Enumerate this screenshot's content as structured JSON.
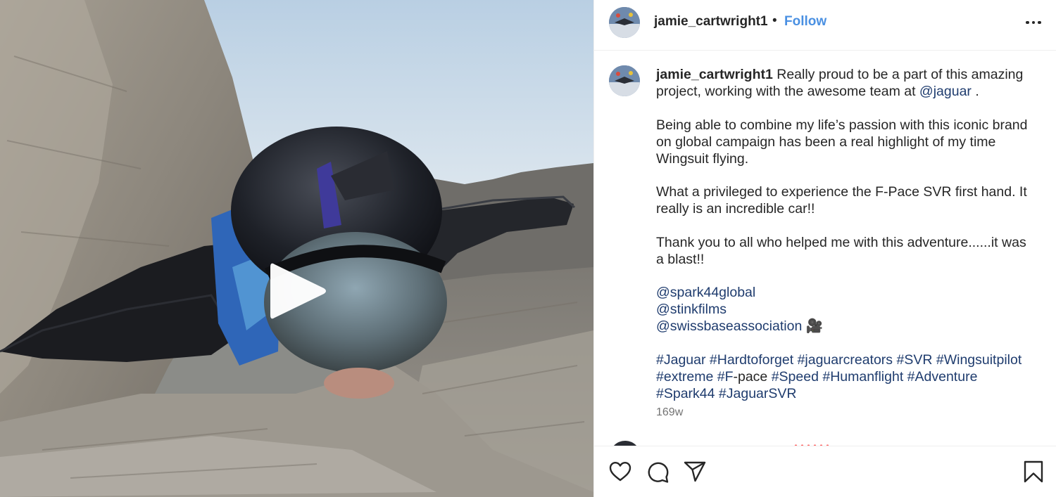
{
  "post": {
    "username": "jamie_cartwright1",
    "separator": "•",
    "follow_label": "Follow",
    "more_options_icon": "more-horizontal-icon"
  },
  "caption": {
    "username": "jamie_cartwright1",
    "intro_text": " Really proud to be a part of this amazing project, working with the awesome team at ",
    "intro_mention": "@jaguar",
    "intro_end": " .",
    "paragraph_2": "Being able to combine my life’s passion with this iconic brand on global campaign has been a real highlight of my time Wingsuit flying.",
    "paragraph_3": "What a privileged to experience the F-Pace SVR first hand. It really is an incredible car!!",
    "paragraph_4": "Thank you to all who helped me with this adventure......it was a blast!!",
    "mentions": [
      "@spark44global",
      "@stinkfilms",
      "@swissbaseassociation"
    ],
    "mention_emoji": "🎥",
    "hashtags_line_1": [
      "#Jaguar",
      "#Hardtoforget",
      "#jaguarcreators",
      "#SVR",
      "#Wingsuitpilot"
    ],
    "hashtag_extreme": "#extreme",
    "hashtag_fpace_link": "#F",
    "hashtag_fpace_rest": "-pace",
    "hashtags_line_2_rest": [
      "#Speed",
      "#Humanflight",
      "#Adventure"
    ],
    "hashtags_line_3": [
      "#Spark44",
      "#JaguarSVR"
    ],
    "timestamp": "169w"
  },
  "media": {
    "type": "video",
    "play_icon": "play-icon"
  },
  "actions": {
    "like_icon": "heart-icon",
    "comment_icon": "comment-bubble-icon",
    "share_icon": "paper-plane-icon",
    "save_icon": "bookmark-icon"
  },
  "colors": {
    "follow": "#4a90e2",
    "link": "#1f3c6e",
    "text": "#262626",
    "muted": "#737373"
  }
}
